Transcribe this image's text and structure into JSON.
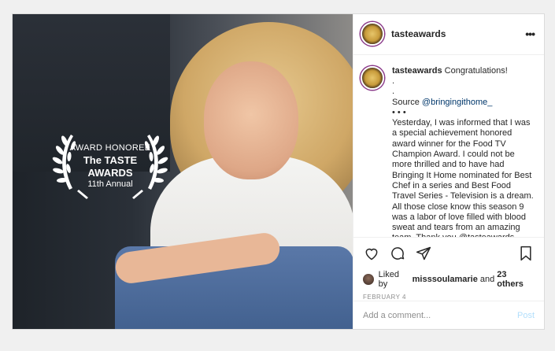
{
  "image": {
    "award": {
      "line1": "AWARD HONOREE",
      "line2": "The TASTE",
      "line3": "AWARDS",
      "line4": "11th Annual"
    }
  },
  "header": {
    "username": "tasteawards",
    "more_label": "•••"
  },
  "caption": {
    "username": "tasteawards",
    "first": "Congratulations!",
    "dot1": ".",
    "dot2": ".",
    "source_prefix": "Source ",
    "source_link": "@bringingithome_",
    "separator": "• • •",
    "body": "Yesterday, I was informed that I was a special achievement honored award winner for the Food TV Champion Award. I could not be more thrilled and to have had Bringing It Home nominated for Best Chef in a series and Best Food Travel Series - Television is a dream. All those close know this season 9 was a labor of love filled with blood sweat and tears from an amazing team. Thank you @tasteawards Harley"
  },
  "icons": {
    "like": "heart-icon",
    "comment": "comment-icon",
    "share": "share-icon",
    "save": "bookmark-icon"
  },
  "likes": {
    "prefix": "Liked by",
    "user": "misssoulamarie",
    "and": "and",
    "others": "23 others"
  },
  "date": "FEBRUARY 4",
  "add_comment": {
    "placeholder": "Add a comment...",
    "post_label": "Post"
  },
  "colors": {
    "link": "#00376b",
    "post_button": "#b2dffc",
    "muted": "#8e8e8e"
  }
}
